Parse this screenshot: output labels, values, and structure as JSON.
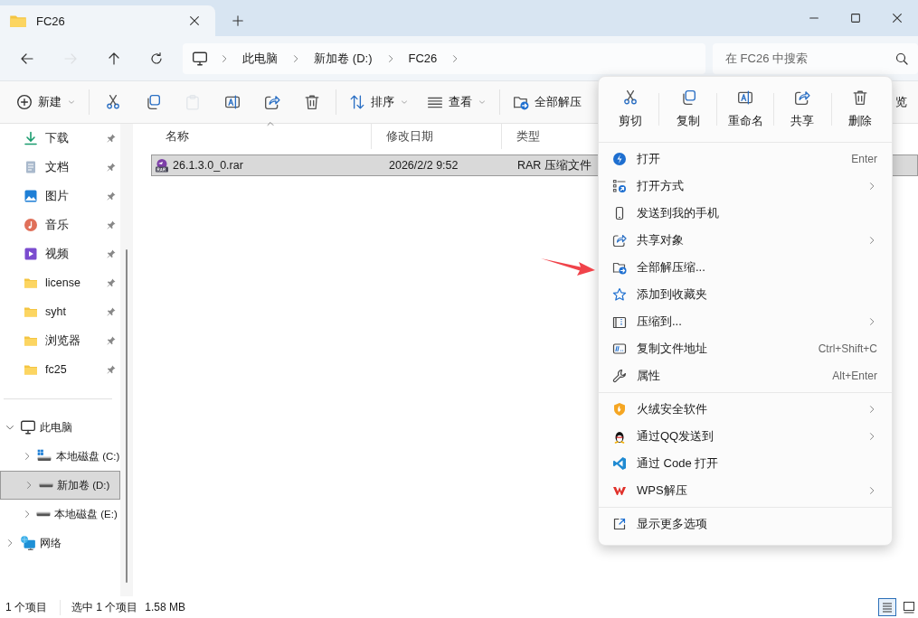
{
  "window": {
    "tabs": [
      {
        "title": "FC26",
        "selected": true
      }
    ]
  },
  "navigation": [
    {
      "kind": "back",
      "disabled": false
    },
    {
      "kind": "forward",
      "disabled": true
    },
    {
      "kind": "up",
      "disabled": false
    },
    {
      "kind": "refresh",
      "disabled": false
    }
  ],
  "address": {
    "crumbs": [
      "此电脑",
      "新加卷 (D:)",
      "FC26"
    ]
  },
  "search": {
    "placeholder": "在 FC26 中搜索"
  },
  "toolbar": [
    {
      "kind": "new",
      "label": "新建",
      "disabled": false
    },
    {
      "kind": "cut",
      "disabled": false
    },
    {
      "kind": "copy",
      "disabled": false
    },
    {
      "kind": "paste",
      "disabled": true
    },
    {
      "kind": "rename",
      "disabled": false
    },
    {
      "kind": "share",
      "disabled": false
    },
    {
      "kind": "delete",
      "disabled": false
    },
    {
      "kind": "sort",
      "label": "排序",
      "disabled": false
    },
    {
      "kind": "view",
      "label": "查看",
      "disabled": false
    },
    {
      "kind": "extract",
      "label": "全部解压",
      "disabled": false
    },
    {
      "kind": "cut-off",
      "label": "览"
    }
  ],
  "sidebar": {
    "quick_access": [
      {
        "kind": "download",
        "label": "下载",
        "pinned": true
      },
      {
        "kind": "documents",
        "label": "文档",
        "pinned": true
      },
      {
        "kind": "pictures",
        "label": "图片",
        "pinned": true
      },
      {
        "kind": "music",
        "label": "音乐",
        "pinned": true
      },
      {
        "kind": "video",
        "label": "视频",
        "pinned": true
      },
      {
        "kind": "folder",
        "label": "license",
        "pinned": true
      },
      {
        "kind": "folder",
        "label": "syht",
        "pinned": true
      },
      {
        "kind": "folder",
        "label": "浏览器",
        "pinned": true
      },
      {
        "kind": "folder",
        "label": "fc25",
        "pinned": true
      }
    ],
    "tree": [
      {
        "kind": "pc",
        "label": "此电脑",
        "expanded": true,
        "selected": false,
        "children": [
          {
            "kind": "system-drive",
            "label": "本地磁盘 (C:)",
            "expanded": false,
            "selected": false
          },
          {
            "kind": "drive",
            "label": "新加卷 (D:)",
            "expanded": false,
            "selected": true
          },
          {
            "kind": "drive",
            "label": "本地磁盘 (E:)",
            "expanded": false,
            "selected": false
          }
        ]
      },
      {
        "kind": "network",
        "label": "网络",
        "expanded": false,
        "selected": false
      }
    ]
  },
  "files": {
    "columns": [
      {
        "label": "名称",
        "sorted": true
      },
      {
        "label": "修改日期",
        "sorted": false
      },
      {
        "label": "类型",
        "sorted": false
      }
    ],
    "rows": [
      {
        "name": "26.1.3.0_0.rar",
        "modified": "2026/2/2 9:52",
        "type": "RAR 压缩文件",
        "selected": true
      }
    ]
  },
  "status_bar": {
    "count": "1 个项目",
    "selection": "选中 1 个项目",
    "size": "1.58 MB",
    "views": [
      {
        "kind": "details",
        "selected": true
      },
      {
        "kind": "tiles",
        "selected": false
      }
    ]
  },
  "context_menu": {
    "actions": [
      {
        "kind": "cut",
        "label": "剪切"
      },
      {
        "kind": "copy",
        "label": "复制"
      },
      {
        "kind": "rename",
        "label": "重命名"
      },
      {
        "kind": "share",
        "label": "共享"
      },
      {
        "kind": "delete",
        "label": "删除"
      }
    ],
    "groups": [
      {
        "items": [
          {
            "kind": "open",
            "label": "打开",
            "shortcut": "Enter",
            "submenu": false
          },
          {
            "kind": "open-with",
            "label": "打开方式",
            "submenu": true
          },
          {
            "kind": "phone",
            "label": "发送到我的手机",
            "submenu": false
          },
          {
            "kind": "share",
            "label": "共享对象",
            "submenu": true
          },
          {
            "kind": "extract",
            "label": "全部解压缩...",
            "submenu": false
          },
          {
            "kind": "star",
            "label": "添加到收藏夹",
            "submenu": false
          },
          {
            "kind": "zip",
            "label": "压缩到...",
            "submenu": true
          },
          {
            "kind": "path",
            "label": "复制文件地址",
            "shortcut": "Ctrl+Shift+C",
            "submenu": false
          },
          {
            "kind": "wrench",
            "label": "属性",
            "shortcut": "Alt+Enter",
            "submenu": false
          }
        ]
      },
      {
        "items": [
          {
            "kind": "shield",
            "label": "火绒安全软件",
            "submenu": true
          },
          {
            "kind": "penguin",
            "label": "通过QQ发送到",
            "submenu": true
          },
          {
            "kind": "code",
            "label": "通过 Code 打开",
            "submenu": false
          },
          {
            "kind": "wps",
            "label": "WPS解压",
            "submenu": true
          }
        ]
      },
      {
        "items": [
          {
            "kind": "more",
            "label": "显示更多选项",
            "submenu": false
          }
        ]
      }
    ]
  }
}
